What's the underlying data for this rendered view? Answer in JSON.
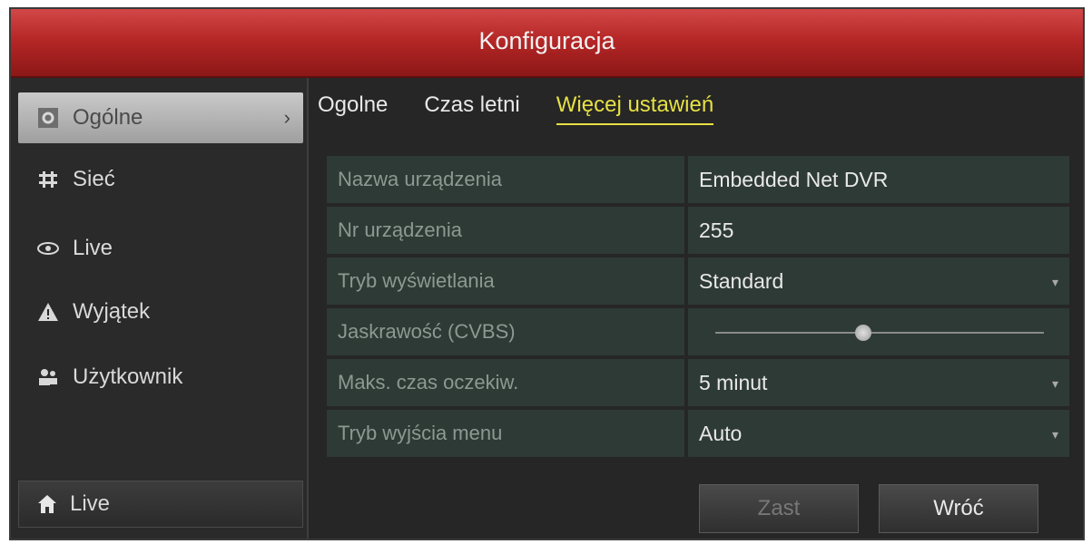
{
  "window": {
    "title": "Konfiguracja"
  },
  "sidebar": {
    "items": [
      {
        "label": "Ogólne",
        "icon": "settings-icon",
        "active": true
      },
      {
        "label": "Sieć",
        "icon": "network-icon"
      },
      {
        "label": "Live",
        "icon": "eye-icon"
      },
      {
        "label": "Wyjątek",
        "icon": "warning-icon"
      },
      {
        "label": "Użytkownik",
        "icon": "users-icon"
      }
    ],
    "bottom_live": {
      "label": "Live",
      "icon": "home-icon"
    }
  },
  "tabs": [
    {
      "label": "Ogolne"
    },
    {
      "label": "Czas letni"
    },
    {
      "label": "Więcej ustawień",
      "active": true
    }
  ],
  "settings": {
    "device_name_label": "Nazwa urządzenia",
    "device_name_value": "Embedded Net DVR",
    "device_no_label": "Nr urządzenia",
    "device_no_value": "255",
    "display_mode_label": "Tryb wyświetlania",
    "display_mode_value": "Standard",
    "brightness_label": "Jaskrawość (CVBS)",
    "brightness_value": 0.45,
    "max_wait_label": "Maks. czas oczekiw.",
    "max_wait_value": "5 minut",
    "menu_output_label": "Tryb wyjścia menu",
    "menu_output_value": "Auto"
  },
  "buttons": {
    "apply": "Zast",
    "back": "Wróć"
  },
  "colors": {
    "title_bar": "#b62727",
    "active_tab": "#e6e045",
    "row_bg": "#2e3a35"
  }
}
